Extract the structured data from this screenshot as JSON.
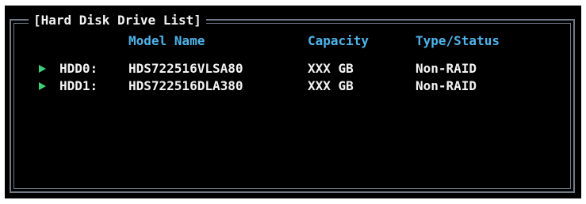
{
  "panel": {
    "title": "[Hard Disk Drive List]"
  },
  "columns": {
    "model": "Model Name",
    "capacity": "Capacity",
    "type_status": "Type/Status"
  },
  "drives": [
    {
      "id": "HDD0:",
      "model": "HDS722516VLSA80",
      "capacity": "XXX GB",
      "type_status": "Non-RAID",
      "icon": "triangle-right-icon"
    },
    {
      "id": "HDD1:",
      "model": "HDS722516DLA380",
      "capacity": "XXX GB",
      "type_status": "Non-RAID",
      "icon": "triangle-right-icon"
    }
  ],
  "colors": {
    "background": "#000000",
    "frame": "#6f7a86",
    "header_text": "#4fb3ea",
    "row_text": "#f2f2f2",
    "arrow": "#3bd17a"
  }
}
